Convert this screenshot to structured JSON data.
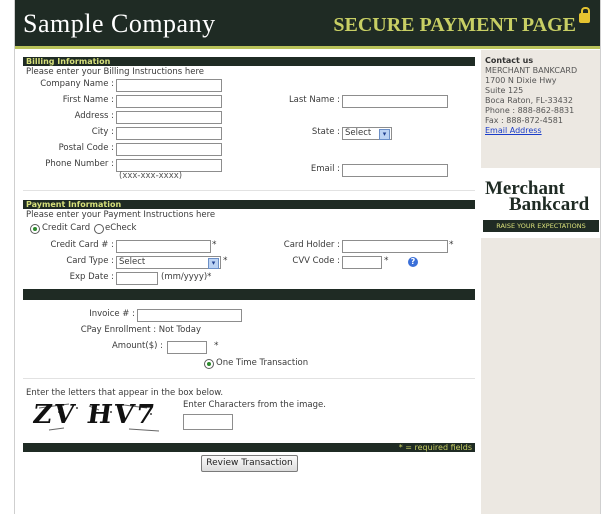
{
  "header": {
    "brand": "Sample Company",
    "secure": "SECURE PAYMENT PAGE"
  },
  "contact": {
    "title": "Contact us",
    "lines": [
      "MERCHANT BANKCARD",
      "1700 N Dixie Hwy",
      "Suite 125",
      "Boca Raton, FL-33432",
      "Phone : 888-862-8831",
      "Fax : 888-872-4581"
    ],
    "email_link": "Email Address"
  },
  "logo": {
    "line1": "Merchant",
    "line2": "Bankcard",
    "tagline": "RAISE YOUR EXPECTATIONS"
  },
  "billing": {
    "title": "Billing Information",
    "instructions": "Please enter your Billing Instructions here",
    "company_label": "Company Name :",
    "first_label": "First Name :",
    "last_label": "Last Name :",
    "address_label": "Address :",
    "city_label": "City :",
    "state_label": "State :",
    "state_value": "Select",
    "postal_label": "Postal Code :",
    "phone_label": "Phone Number :",
    "phone_hint": "(xxx-xxx-xxxx)",
    "email_label": "Email :"
  },
  "payment": {
    "title": "Payment Information",
    "instructions": "Please enter your Payment Instructions here",
    "credit_card": "Credit Card",
    "echeck": "eCheck",
    "cc_label": "Credit Card # :",
    "holder_label": "Card Holder :",
    "type_label": "Card Type :",
    "type_value": "Select",
    "cvv_label": "CVV Code :",
    "exp_label": "Exp Date :",
    "exp_hint": "(mm/yyyy)*",
    "required_mark": "*"
  },
  "invoice": {
    "invoice_label": "Invoice # :",
    "cpay": "CPay Enrollment : Not Today",
    "amount_label": "Amount($) :",
    "one_time": "One Time Transaction"
  },
  "captcha": {
    "prompt": "Enter the letters that appear in the box below.",
    "image_text": "ZV HV7",
    "instruction": "Enter Characters from the image."
  },
  "footer": {
    "required_note": "* = required fields",
    "review_button": "Review Transaction"
  },
  "colors": {
    "dark_green": "#1f2b24",
    "accent": "#c8cf64",
    "link": "#1a3cc9"
  }
}
